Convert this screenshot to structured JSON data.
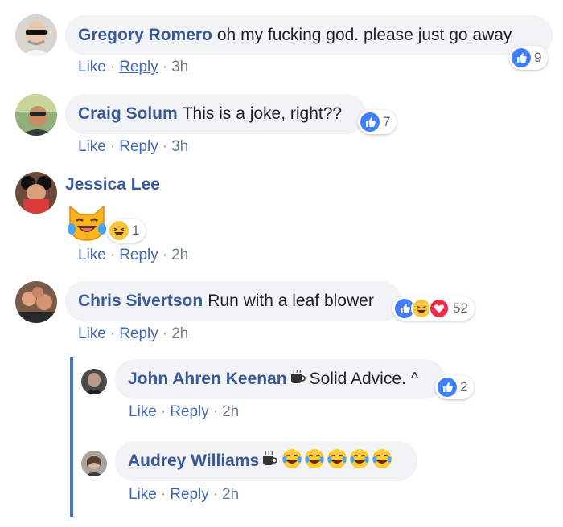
{
  "comments": [
    {
      "author": "Gregory Romero",
      "text": "oh my fucking god. please just go away",
      "reaction_count": "9",
      "actions": {
        "like": "Like",
        "reply": "Reply",
        "time": "3h"
      }
    },
    {
      "author": "Craig Solum",
      "text": "This is a joke, right??",
      "reaction_count": "7",
      "actions": {
        "like": "Like",
        "reply": "Reply",
        "time": "3h"
      }
    },
    {
      "author": "Jessica Lee",
      "reaction_count": "1",
      "actions": {
        "like": "Like",
        "reply": "Reply",
        "time": "2h"
      }
    },
    {
      "author": "Chris Sivertson",
      "text": "Run with a leaf blower",
      "reaction_count": "52",
      "actions": {
        "like": "Like",
        "reply": "Reply",
        "time": "2h"
      }
    }
  ],
  "replies": [
    {
      "author": "John Ahren Keenan",
      "text": "Solid Advice. ^",
      "reaction_count": "2",
      "actions": {
        "like": "Like",
        "reply": "Reply",
        "time": "2h"
      }
    },
    {
      "author": "Audrey Williams",
      "actions": {
        "like": "Like",
        "reply": "Reply",
        "time": "2h"
      }
    }
  ],
  "colors": {
    "name": "#385898",
    "link": "#4267b2",
    "bubble": "#f2f3f5",
    "thread_line": "#4a76c8",
    "like": "#4080ff",
    "haha": "#f7c53d",
    "love": "#f0284a"
  },
  "icons": [
    "like-icon",
    "haha-icon",
    "love-icon",
    "coffee-cup-icon",
    "laughing-emoji-icon",
    "laughing-cat-sticker"
  ]
}
